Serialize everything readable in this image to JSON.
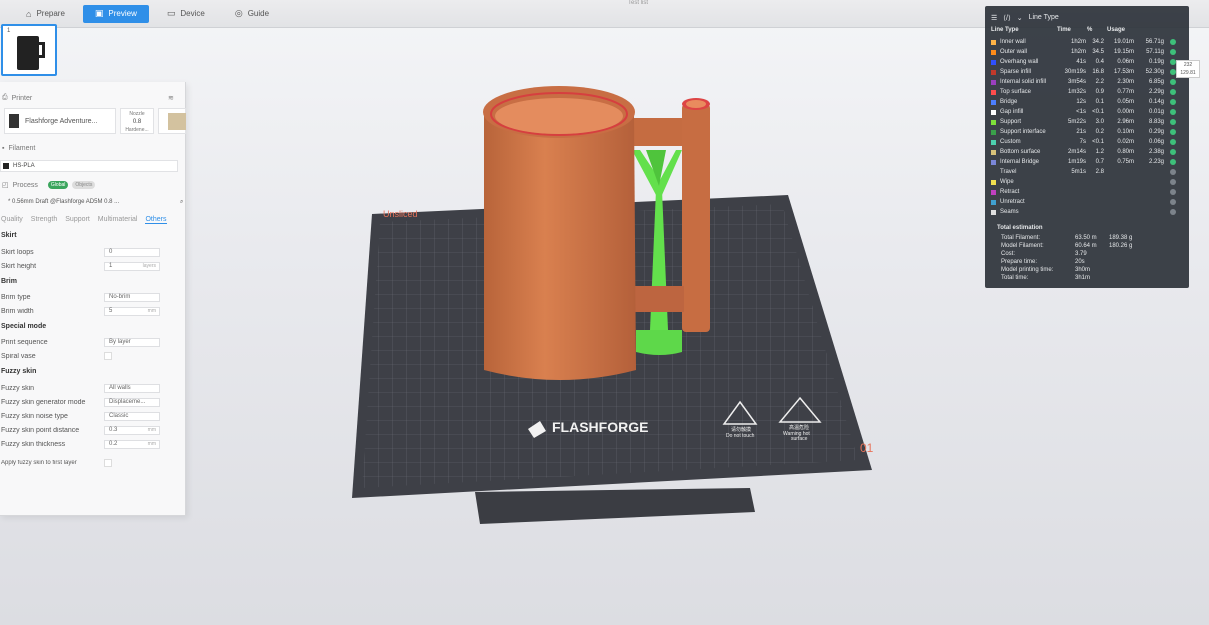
{
  "window": {
    "title": "Test list"
  },
  "topbar": {
    "tabs": [
      {
        "label": "Prepare",
        "icon": "home-icon"
      },
      {
        "label": "Preview",
        "icon": "preview-icon",
        "active": true
      },
      {
        "label": "Device",
        "icon": "device-icon"
      },
      {
        "label": "Guide",
        "icon": "guide-icon"
      }
    ]
  },
  "plate": {
    "number": "1"
  },
  "left_panel": {
    "printer": {
      "header": "Printer",
      "name": "Flashforge Adventure...",
      "nozzle_label": "Nozzle",
      "nozzle_value": "0.8",
      "nozzle_sub": "Hardene..."
    },
    "filament": {
      "header": "Filament",
      "name": "HS-PLA"
    },
    "process": {
      "header": "Process",
      "toggle_global": "Global",
      "toggle_objects": "Objects",
      "preset": "* 0.56mm Draft @Flashforge AD5M 0.8 ...",
      "subtabs": [
        "Quality",
        "Strength",
        "Support",
        "Multimaterial",
        "Others"
      ],
      "active_subtab": "Others"
    },
    "groups": {
      "skirt": "Skirt",
      "brim": "Brim",
      "special": "Special mode",
      "fuzzy": "Fuzzy skin"
    },
    "fields": {
      "skirt_loops": {
        "label": "Skirt loops",
        "value": "0"
      },
      "skirt_height": {
        "label": "Skirt height",
        "value": "1",
        "unit": "layers"
      },
      "brim_type": {
        "label": "Brim type",
        "value": "No-brim"
      },
      "brim_width": {
        "label": "Brim width",
        "value": "5",
        "unit": "mm"
      },
      "print_sequence": {
        "label": "Print sequence",
        "value": "By layer"
      },
      "spiral_vase": {
        "label": "Spiral vase"
      },
      "fuzzy_skin": {
        "label": "Fuzzy skin",
        "value": "All walls"
      },
      "fuzzy_mode": {
        "label": "Fuzzy skin generator mode",
        "value": "Displaceme..."
      },
      "fuzzy_noise": {
        "label": "Fuzzy skin noise type",
        "value": "Classic"
      },
      "fuzzy_point": {
        "label": "Fuzzy skin point distance",
        "value": "0.3",
        "unit": "mm"
      },
      "fuzzy_thick": {
        "label": "Fuzzy skin thickness",
        "value": "0.2",
        "unit": "mm"
      },
      "fuzzy_first": {
        "label": "Apply fuzzy skin to first layer"
      }
    }
  },
  "stats": {
    "title": "Line Type",
    "columns": {
      "name": "Line Type",
      "time": "Time",
      "pct": "%",
      "usage": "Usage"
    },
    "rows": [
      {
        "name": "Inner wall",
        "time": "1h2m",
        "pct": "34.2",
        "len": "19.01m",
        "wt": "56.71g",
        "color": "#ffb347"
      },
      {
        "name": "Outer wall",
        "time": "1h2m",
        "pct": "34.5",
        "len": "19.15m",
        "wt": "57.11g",
        "color": "#ff8c1a"
      },
      {
        "name": "Overhang wall",
        "time": "41s",
        "pct": "0.4",
        "len": "0.06m",
        "wt": "0.19g",
        "color": "#3050ff"
      },
      {
        "name": "Sparse infill",
        "time": "30m19s",
        "pct": "16.8",
        "len": "17.53m",
        "wt": "52.30g",
        "color": "#c0392b"
      },
      {
        "name": "Internal solid infill",
        "time": "3m54s",
        "pct": "2.2",
        "len": "2.30m",
        "wt": "6.85g",
        "color": "#9b3fbf"
      },
      {
        "name": "Top surface",
        "time": "1m32s",
        "pct": "0.9",
        "len": "0.77m",
        "wt": "2.29g",
        "color": "#ff4d4d"
      },
      {
        "name": "Bridge",
        "time": "12s",
        "pct": "0.1",
        "len": "0.05m",
        "wt": "0.14g",
        "color": "#4d7fff"
      },
      {
        "name": "Gap infill",
        "time": "<1s",
        "pct": "<0.1",
        "len": "0.00m",
        "wt": "0.01g",
        "color": "#ffffff"
      },
      {
        "name": "Support",
        "time": "5m22s",
        "pct": "3.0",
        "len": "2.96m",
        "wt": "8.83g",
        "color": "#7fe03a"
      },
      {
        "name": "Support interface",
        "time": "21s",
        "pct": "0.2",
        "len": "0.10m",
        "wt": "0.29g",
        "color": "#3aa04a"
      },
      {
        "name": "Custom",
        "time": "7s",
        "pct": "<0.1",
        "len": "0.02m",
        "wt": "0.06g",
        "color": "#4dd0b0"
      },
      {
        "name": "Bottom surface",
        "time": "2m14s",
        "pct": "1.2",
        "len": "0.80m",
        "wt": "2.38g",
        "color": "#d8c37a"
      },
      {
        "name": "Internal Bridge",
        "time": "1m19s",
        "pct": "0.7",
        "len": "0.75m",
        "wt": "2.23g",
        "color": "#7a86d8"
      },
      {
        "name": "Travel",
        "time": "5m1s",
        "pct": "2.8",
        "len": "",
        "wt": "",
        "color": ""
      },
      {
        "name": "Wipe",
        "time": "",
        "pct": "",
        "len": "",
        "wt": "",
        "color": "#f0e050"
      },
      {
        "name": "Retract",
        "time": "",
        "pct": "",
        "len": "",
        "wt": "",
        "color": "#c040c0"
      },
      {
        "name": "Unretract",
        "time": "",
        "pct": "",
        "len": "",
        "wt": "",
        "color": "#40a0d0"
      },
      {
        "name": "Seams",
        "time": "",
        "pct": "",
        "len": "",
        "wt": "",
        "color": "#e0e0e0"
      }
    ],
    "total_title": "Total estimation",
    "totals": [
      {
        "k": "Total Filament:",
        "v1": "63.50 m",
        "v2": "189.38 g"
      },
      {
        "k": "Model Filament:",
        "v1": "60.64 m",
        "v2": "180.26 g"
      },
      {
        "k": "Cost:",
        "v1": "3.79",
        "v2": ""
      },
      {
        "k": "Prepare time:",
        "v1": "20s",
        "v2": ""
      },
      {
        "k": "Model printing time:",
        "v1": "3h0m",
        "v2": ""
      },
      {
        "k": "Total time:",
        "v1": "3h1m",
        "v2": ""
      }
    ]
  },
  "ruler": {
    "top": "232",
    "bottom": "129.81"
  },
  "viewport": {
    "bed_brand": "FLASHFORGE",
    "warn_left_1": "请勿触摸",
    "warn_left_2": "Do not touch",
    "warn_right_1": "高温危险",
    "warn_right_2": "Warning hot",
    "warn_right_3": "surface",
    "plate_label": "01",
    "model_tag": "Unsliced"
  }
}
